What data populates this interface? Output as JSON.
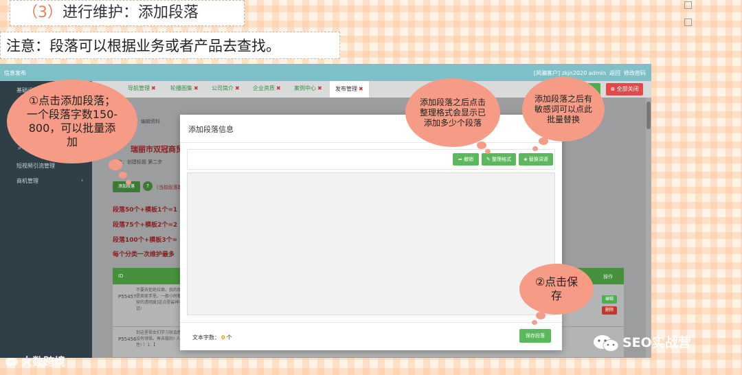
{
  "slide": {
    "step_number": "（3）",
    "step_title": "进行维护：添加段落",
    "note": "注意：段落可以根据业务或者产品去查找。"
  },
  "app": {
    "brand": "信息发布",
    "user_info": "[凤骗客户] zkjn2020 admin",
    "link_back": "返回",
    "link_password": "修改密码",
    "close_all": "全部关闭",
    "tabs": [
      {
        "label": "导航管理"
      },
      {
        "label": "轮播图集"
      },
      {
        "label": "公司简介"
      },
      {
        "label": "企业资质"
      },
      {
        "label": "案例中心"
      },
      {
        "label": "发布管理"
      }
    ],
    "sidebar_items": [
      {
        "label": "基础设置"
      },
      {
        "label": "短视频引流管理"
      },
      {
        "label": "商机管理"
      }
    ],
    "company_heading": "瑞丽市双冠商贸",
    "step_line": "一步：创建标题    第二步",
    "add_paragraph_btn": "添加段落",
    "current_hint": "(当前段落数",
    "rules": [
      "段落50个+模板1个=1",
      "段落75个+模板2个=2",
      "段落100个+模板3个=",
      "每个分类一次维护最多"
    ],
    "table_head_id": "ID",
    "table_head_action": "操作",
    "rows": [
      {
        "id": "P55457",
        "text": "不要去拒绝拉面。我的朋友是商家手里。一般小时都看穿的透明度]这点是最神者话!"
      },
      {
        "id": "P55456",
        "text": "到这里翠女们学习就会感觉没有领悟。再去做的! 人性! ）1.【"
      }
    ],
    "row_btn_edit": "编辑",
    "row_btn_delete": "删除",
    "bg_label": "编辑资料"
  },
  "modal": {
    "title": "添加段落信息",
    "btn_undo": "撤销",
    "btn_format": "整理格式",
    "btn_replace": "替换词语",
    "count_label": "文本字数：",
    "count_value": "0",
    "count_unit": "个",
    "save": "保存段落"
  },
  "callouts": {
    "c1": "①点击添加段落；一个段落字数150-800，可以批量添加",
    "c2": "添加段落之后点击整理格式会显示已添加多少个段落",
    "c3": "添加段落之后有敏感词可以点此批量替换",
    "c4": "②点击保存"
  },
  "watermark": "大数跨境",
  "seo_badge": "SEO实战营",
  "colors": {
    "accent_orange": "#e8825a",
    "bubble": "#f59b86",
    "green": "#5cb85c",
    "red": "#e24a4a",
    "topbar": "#7fc0c8",
    "sidebar": "#2f3f47"
  }
}
